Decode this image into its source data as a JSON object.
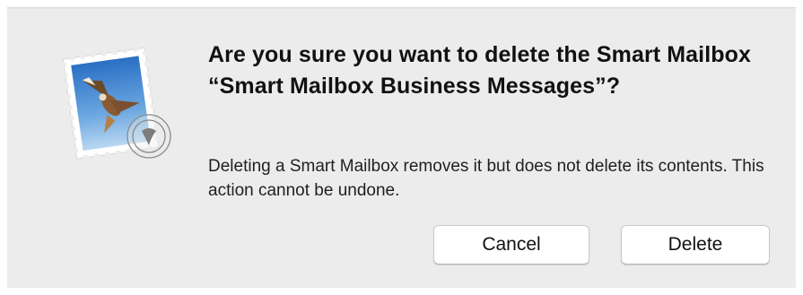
{
  "dialog": {
    "app_icon": "mail-stamp-icon",
    "title": "Are you sure you want to delete the Smart Mailbox “Smart Mailbox Business Messages”?",
    "message": "Deleting a Smart Mailbox removes it but does not delete its contents. This action cannot be undone.",
    "buttons": {
      "cancel_label": "Cancel",
      "delete_label": "Delete"
    }
  },
  "colors": {
    "dialog_background": "#ececec",
    "button_background": "#ffffff",
    "text": "#111111"
  }
}
